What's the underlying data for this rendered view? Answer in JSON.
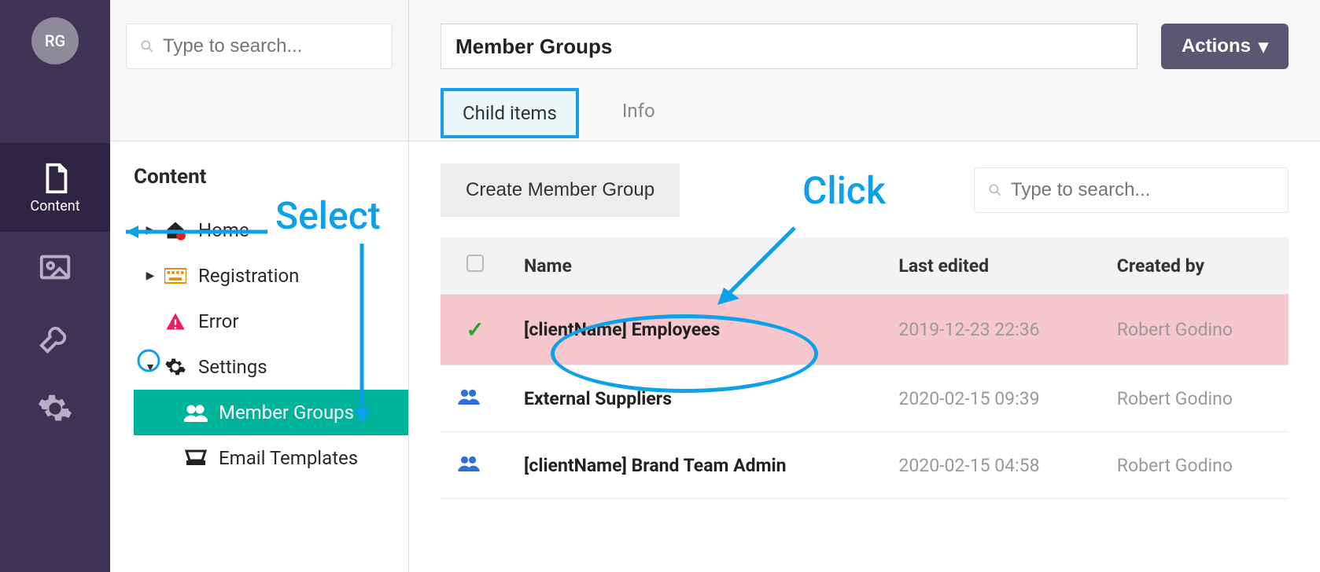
{
  "avatar_initials": "RG",
  "rail": {
    "content_label": "Content"
  },
  "search": {
    "placeholder": "Type to search..."
  },
  "tree": {
    "section": "Content",
    "home": "Home",
    "registration": "Registration",
    "error": "Error",
    "settings": "Settings",
    "member_groups": "Member Groups",
    "email_templates": "Email Templates"
  },
  "header": {
    "title_value": "Member Groups",
    "actions_label": "Actions"
  },
  "tabs": {
    "child_items": "Child items",
    "info": "Info"
  },
  "toolbar": {
    "create_label": "Create Member Group",
    "table_search_placeholder": "Type to search..."
  },
  "table": {
    "cols": {
      "name": "Name",
      "last_edited": "Last edited",
      "created_by": "Created by"
    },
    "rows": [
      {
        "checked": true,
        "name": "[clientName] Employees",
        "last_edited": "2019-12-23 22:36",
        "created_by": "Robert Godino"
      },
      {
        "checked": false,
        "name": "External Suppliers",
        "last_edited": "2020-02-15 09:39",
        "created_by": "Robert Godino"
      },
      {
        "checked": false,
        "name": "[clientName] Brand Team Admin",
        "last_edited": "2020-02-15 04:58",
        "created_by": "Robert Godino"
      }
    ]
  },
  "annotations": {
    "select": "Select",
    "click": "Click"
  }
}
